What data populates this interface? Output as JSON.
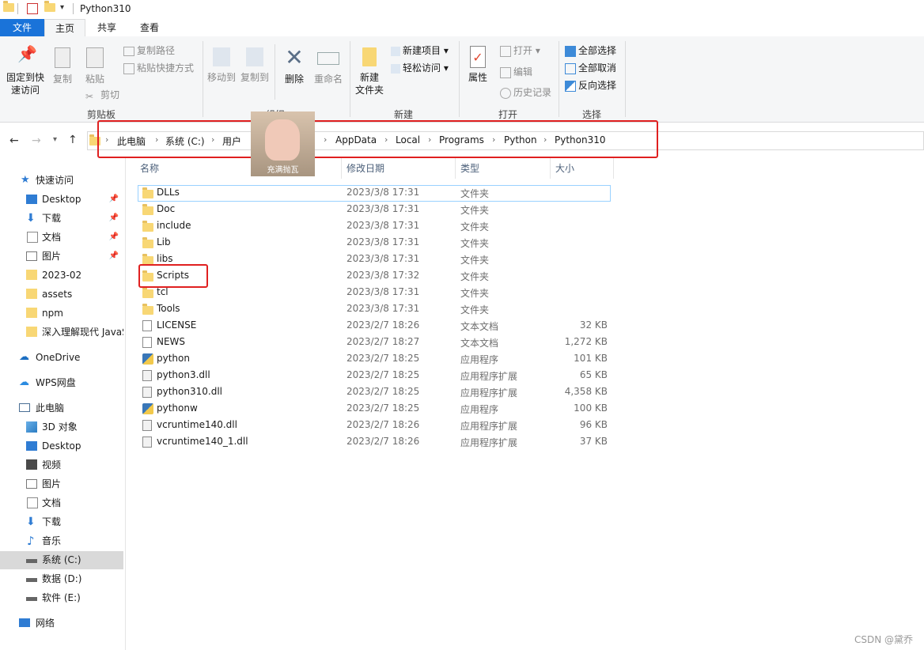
{
  "window": {
    "title": "Python310"
  },
  "tabs": [
    "文件",
    "主页",
    "共享",
    "查看"
  ],
  "ribbon": {
    "clipboard": {
      "pin": "固定到快",
      "pin2": "速访问",
      "copy": "复制",
      "paste": "粘贴",
      "copy_path": "复制路径",
      "paste_shortcut": "粘贴快捷方式",
      "cut": "剪切",
      "group": "剪贴板"
    },
    "organize": {
      "move_to": "移动到",
      "copy_to": "复制到",
      "delete": "删除",
      "rename": "重命名",
      "group": "组织"
    },
    "new": {
      "new_folder": "新建",
      "new_folder2": "文件夹",
      "new_item": "新建项目",
      "easy_access": "轻松访问",
      "group": "新建"
    },
    "open": {
      "properties": "属性",
      "open": "打开",
      "edit": "编辑",
      "history": "历史记录",
      "group": "打开"
    },
    "select": {
      "select_all": "全部选择",
      "select_none": "全部取消",
      "invert": "反向选择",
      "group": "选择"
    }
  },
  "address": {
    "crumbs": [
      "此电脑",
      "系统 (C:)",
      "用户",
      "AppData",
      "Local",
      "Programs",
      "Python",
      "Python310"
    ]
  },
  "sticker_text": "充满抛瓦",
  "nav": {
    "quick_access": "快速访问",
    "quick_items": [
      "Desktop",
      "下载",
      "文档",
      "图片",
      "2023-02",
      "assets",
      "npm",
      "深入理解现代 JavaS"
    ],
    "onedrive": "OneDrive",
    "wps": "WPS网盘",
    "this_pc": "此电脑",
    "pc_items": [
      "3D 对象",
      "Desktop",
      "视频",
      "图片",
      "文档",
      "下载",
      "音乐",
      "系统 (C:)",
      "数据 (D:)",
      "软件 (E:)"
    ],
    "network": "网络"
  },
  "columns": {
    "name": "名称",
    "date": "修改日期",
    "type": "类型",
    "size": "大小"
  },
  "files": [
    {
      "name": "DLLs",
      "date": "2023/3/8 17:31",
      "type": "文件夹",
      "size": "",
      "icon": "folder"
    },
    {
      "name": "Doc",
      "date": "2023/3/8 17:31",
      "type": "文件夹",
      "size": "",
      "icon": "folder"
    },
    {
      "name": "include",
      "date": "2023/3/8 17:31",
      "type": "文件夹",
      "size": "",
      "icon": "folder"
    },
    {
      "name": "Lib",
      "date": "2023/3/8 17:31",
      "type": "文件夹",
      "size": "",
      "icon": "folder"
    },
    {
      "name": "libs",
      "date": "2023/3/8 17:31",
      "type": "文件夹",
      "size": "",
      "icon": "folder"
    },
    {
      "name": "Scripts",
      "date": "2023/3/8 17:32",
      "type": "文件夹",
      "size": "",
      "icon": "folder"
    },
    {
      "name": "tcl",
      "date": "2023/3/8 17:31",
      "type": "文件夹",
      "size": "",
      "icon": "folder"
    },
    {
      "name": "Tools",
      "date": "2023/3/8 17:31",
      "type": "文件夹",
      "size": "",
      "icon": "folder"
    },
    {
      "name": "LICENSE",
      "date": "2023/2/7 18:26",
      "type": "文本文档",
      "size": "32 KB",
      "icon": "text"
    },
    {
      "name": "NEWS",
      "date": "2023/2/7 18:27",
      "type": "文本文档",
      "size": "1,272 KB",
      "icon": "text"
    },
    {
      "name": "python",
      "date": "2023/2/7 18:25",
      "type": "应用程序",
      "size": "101 KB",
      "icon": "exe"
    },
    {
      "name": "python3.dll",
      "date": "2023/2/7 18:25",
      "type": "应用程序扩展",
      "size": "65 KB",
      "icon": "dll"
    },
    {
      "name": "python310.dll",
      "date": "2023/2/7 18:25",
      "type": "应用程序扩展",
      "size": "4,358 KB",
      "icon": "dll"
    },
    {
      "name": "pythonw",
      "date": "2023/2/7 18:25",
      "type": "应用程序",
      "size": "100 KB",
      "icon": "exe"
    },
    {
      "name": "vcruntime140.dll",
      "date": "2023/2/7 18:26",
      "type": "应用程序扩展",
      "size": "96 KB",
      "icon": "dll"
    },
    {
      "name": "vcruntime140_1.dll",
      "date": "2023/2/7 18:26",
      "type": "应用程序扩展",
      "size": "37 KB",
      "icon": "dll"
    }
  ],
  "watermark": "CSDN @黛乔"
}
